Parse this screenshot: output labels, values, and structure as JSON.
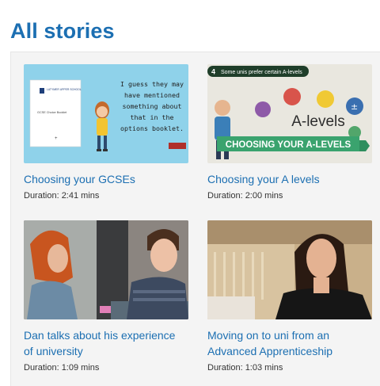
{
  "page": {
    "title": "All stories"
  },
  "stories": [
    {
      "title": "Choosing your GCSEs",
      "duration": "Duration: 2:41 mins",
      "thumb": {
        "booklet_school": "LATYMER UPPER SCHOOL",
        "booklet_title": "GCSE Choice Booklet",
        "speech": [
          "I guess they may",
          "have mentioned",
          "something about",
          "that in the",
          "options booklet."
        ]
      }
    },
    {
      "title": "Choosing your A levels",
      "duration": "Duration: 2:00 mins",
      "thumb": {
        "number": "4",
        "caption": "Some unis prefer certain A-levels",
        "center_label": "A-levels",
        "banner": "CHOOSING YOUR A-LEVELS"
      }
    },
    {
      "title": "Dan talks about his experience of university",
      "title_lines": [
        "Dan talks about his experience",
        "of university"
      ],
      "duration": "Duration: 1:09 mins"
    },
    {
      "title": "Moving on to uni from an Advanced Apprenticeship",
      "title_lines": [
        "Moving on to uni from an",
        "Advanced Apprenticeship"
      ],
      "duration": "Duration: 1:03 mins"
    }
  ],
  "colors": {
    "accent": "#1c6fb2",
    "panel": "#f4f4f4"
  }
}
